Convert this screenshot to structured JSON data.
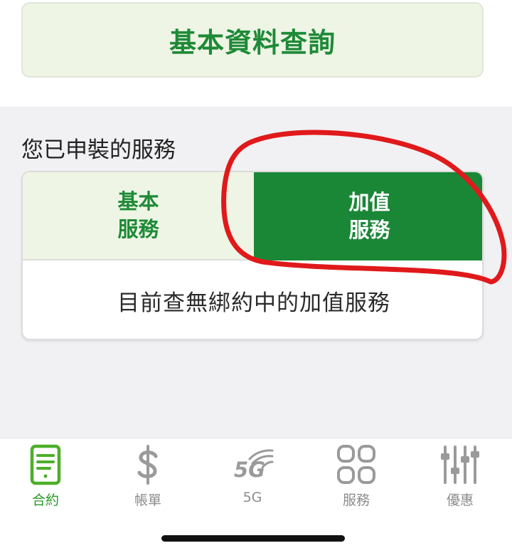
{
  "header": {
    "query_button_label": "基本資料查詢"
  },
  "services": {
    "section_title": "您已申裝的服務",
    "tabs": [
      {
        "label": "基本服務",
        "selected": false
      },
      {
        "label": "加值服務",
        "selected": true
      }
    ],
    "empty_message": "目前查無綁約中的加值服務"
  },
  "tab_bar": {
    "items": [
      {
        "label": "合約",
        "icon": "contract-icon",
        "active": true
      },
      {
        "label": "帳單",
        "icon": "dollar-icon",
        "active": false
      },
      {
        "label": "5G",
        "icon": "5g-icon",
        "active": false
      },
      {
        "label": "服務",
        "icon": "services-grid-icon",
        "active": false
      },
      {
        "label": "優惠",
        "icon": "sliders-icon",
        "active": false
      }
    ]
  },
  "colors": {
    "brand_green": "#1a8737",
    "light_green": "#eef5e5",
    "active_tab_icon": "#4caf2a",
    "inactive_icon": "#9a9a9a",
    "annotation_red": "#e0191b"
  }
}
